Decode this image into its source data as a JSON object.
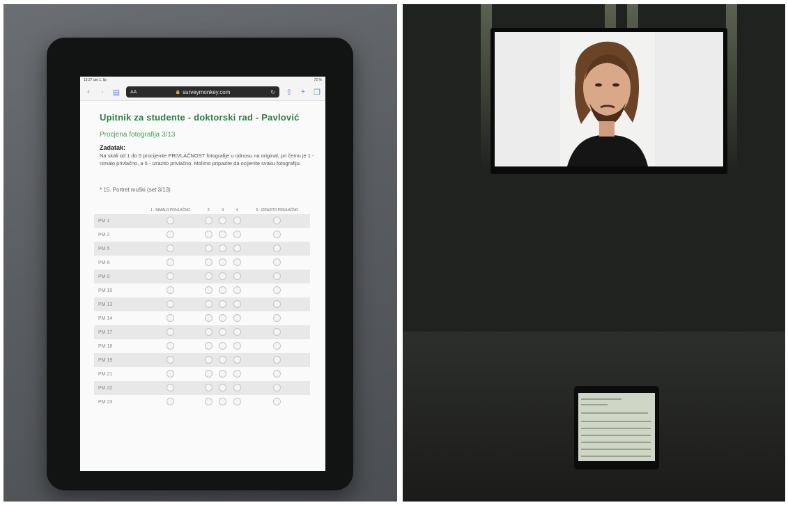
{
  "tablet": {
    "status": {
      "time": "15:27 uto 1. lip",
      "battery": "72 %"
    },
    "browser": {
      "text_size_label": "AA",
      "url": "surveymonkey.com"
    },
    "survey": {
      "title": "Upitnik za studente - doktorski rad - Pavlović",
      "progress": "Procjena fotografija 3/13",
      "task_heading": "Zadatak:",
      "task_text": "Na skali od 1 do 5 procijenite PRIVLAČNOST fotografije u odnosu na original, pri čemu je 1 - nimalo privlačno, a 5 - izrazito privlačno. Molimo pripazite da ocijenite svaku fotografiju.",
      "question": "* 15. Portret muški (set 3/13)",
      "columns": [
        "1 - NIMALO PRIVLAČNO",
        "2",
        "3",
        "4",
        "5 - IZRAZITO PRIVLAČNO"
      ],
      "rows": [
        "PM 1",
        "PM 2",
        "PM 5",
        "PM 6",
        "PM 9",
        "PM 10",
        "PM 13",
        "PM 14",
        "PM 17",
        "PM 18",
        "PM 19",
        "PM 21",
        "PM 22",
        "PM 23"
      ]
    }
  },
  "colors": {
    "title_green": "#2f7d45",
    "progress_green": "#4d9a60"
  }
}
